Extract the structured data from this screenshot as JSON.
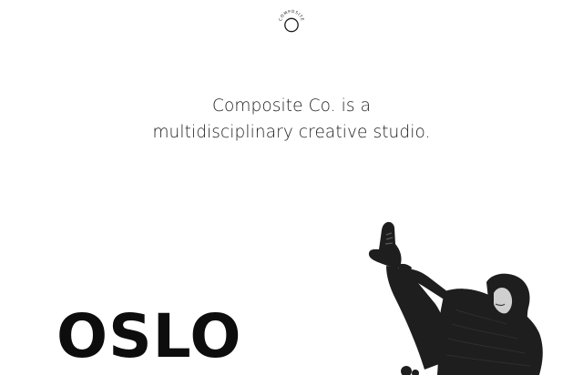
{
  "header": {
    "logo_text": "COMPOSITE",
    "logo_icon": "composite-circle-logo"
  },
  "intro": {
    "line1": "Composite Co. is a",
    "line2": "multidisciplinary creative studio."
  },
  "project": {
    "title": "OSLO",
    "image": "grayscale-photo-person-kicking-leg-up",
    "image_tone": "#1e1e1e"
  }
}
